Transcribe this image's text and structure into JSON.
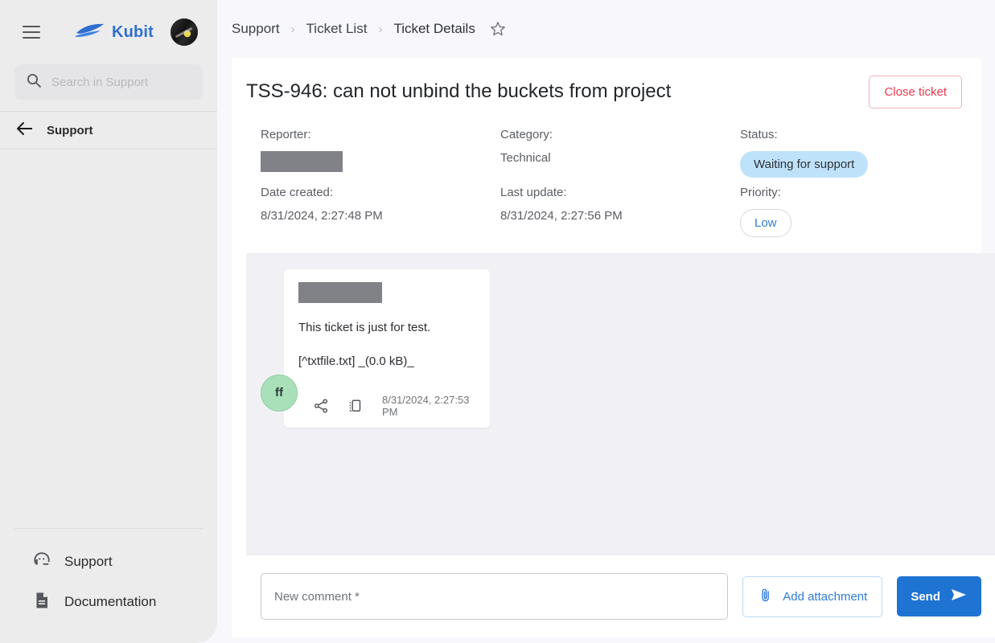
{
  "sidebar": {
    "menu_icon": "hamburger-icon",
    "brand": {
      "name": "Kubit",
      "logo_icon": "kubit-boat-logo",
      "color": "#2f6fd0"
    },
    "user_avatar": "user-avatar-photo",
    "search": {
      "placeholder": "Search in Support",
      "value": "",
      "icon": "search-icon"
    },
    "back_item": {
      "label": "Support",
      "icon": "arrow-left-icon"
    },
    "bottom_items": [
      {
        "label": "Support",
        "icon": "headset-icon"
      },
      {
        "label": "Documentation",
        "icon": "document-icon"
      }
    ]
  },
  "breadcrumb": {
    "items": [
      "Support",
      "Ticket List",
      "Ticket Details"
    ],
    "separator": "›",
    "favorite_icon": "star-outline-icon"
  },
  "ticket": {
    "title": "TSS-946: can not unbind the buckets from project",
    "close_button": "Close ticket",
    "close_button_color": "#e8384f",
    "labels": {
      "reporter": "Reporter:",
      "category": "Category:",
      "status": "Status:",
      "date_created": "Date created:",
      "last_update": "Last update:",
      "priority": "Priority:"
    },
    "values": {
      "reporter": "",
      "category": "Technical",
      "status": "Waiting for support",
      "status_color": "#bfe2fb",
      "date_created": "8/31/2024, 2:27:48 PM",
      "last_update": "8/31/2024, 2:27:56 PM",
      "priority": "Low",
      "priority_color": "#2f7bd6"
    }
  },
  "conversation": {
    "messages": [
      {
        "avatar_initials": "ff",
        "avatar_color": "#a9e0b9",
        "author": "",
        "text": "This ticket is just for test.",
        "attachment": "[^txtfile.txt] _(0.0 kB)_",
        "timestamp": "8/31/2024, 2:27:53 PM",
        "actions": [
          "share-icon",
          "copy-icon"
        ]
      }
    ]
  },
  "composer": {
    "placeholder": "New comment *",
    "value": "",
    "attach_label": "Add attachment",
    "attach_icon": "paperclip-icon",
    "send_label": "Send",
    "send_icon": "send-arrow-icon",
    "send_color": "#1f73d2"
  }
}
